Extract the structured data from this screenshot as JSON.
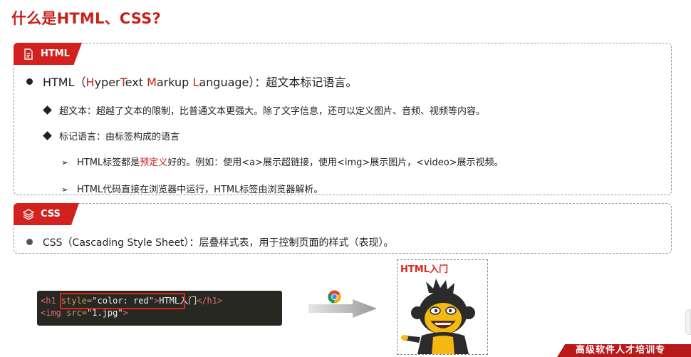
{
  "title": "什么是HTML、CSS?",
  "html_section": {
    "tag_label": "HTML",
    "tag_icon": "document-icon",
    "definition": {
      "prefix": "HTML（",
      "H": "H",
      "yper": "yper",
      "T": "T",
      "ext": "ext ",
      "M": "M",
      "arkup": "arkup ",
      "L": "L",
      "anguage": "anguage",
      "suffix": "）：超文本标记语言。"
    },
    "hypertext": "超文本：超越了文本的限制，比普通文本更强大。除了文字信息，还可以定义图片、音频、视频等内容。",
    "markup_language": "标记语言：由标签构成的语言",
    "predefined_prefix": "HTML标签都是",
    "predefined_highlight": "预定义",
    "predefined_suffix": "好的。例如：使用<a>展示超链接，使用<img>展示图片，<video>展示视频。",
    "browser_run": "HTML代码直接在浏览器中运行，HTML标签由浏览器解析。"
  },
  "css_section": {
    "tag_label": "CSS",
    "tag_icon": "layers-icon",
    "definition": "CSS（Cascading Style Sheet）：层叠样式表，用于控制页面的样式（表现）。"
  },
  "code": {
    "line1_open": "<h1",
    "line1_attr": " style=",
    "line1_str": "\"color: red\"",
    "line1_gt": ">",
    "line1_text": "HTML入门",
    "line1_close": "</h1>",
    "line2_open": "<img",
    "line2_attr": " src=",
    "line2_str": "\"1.jpg\"",
    "line2_gt": ">"
  },
  "output": {
    "heading": "HTML入门"
  },
  "banner": "高级软件人才培训专",
  "colors": {
    "accent_red": "#c8211b",
    "tag_red": "#d2211e",
    "code_bg": "#272822"
  }
}
